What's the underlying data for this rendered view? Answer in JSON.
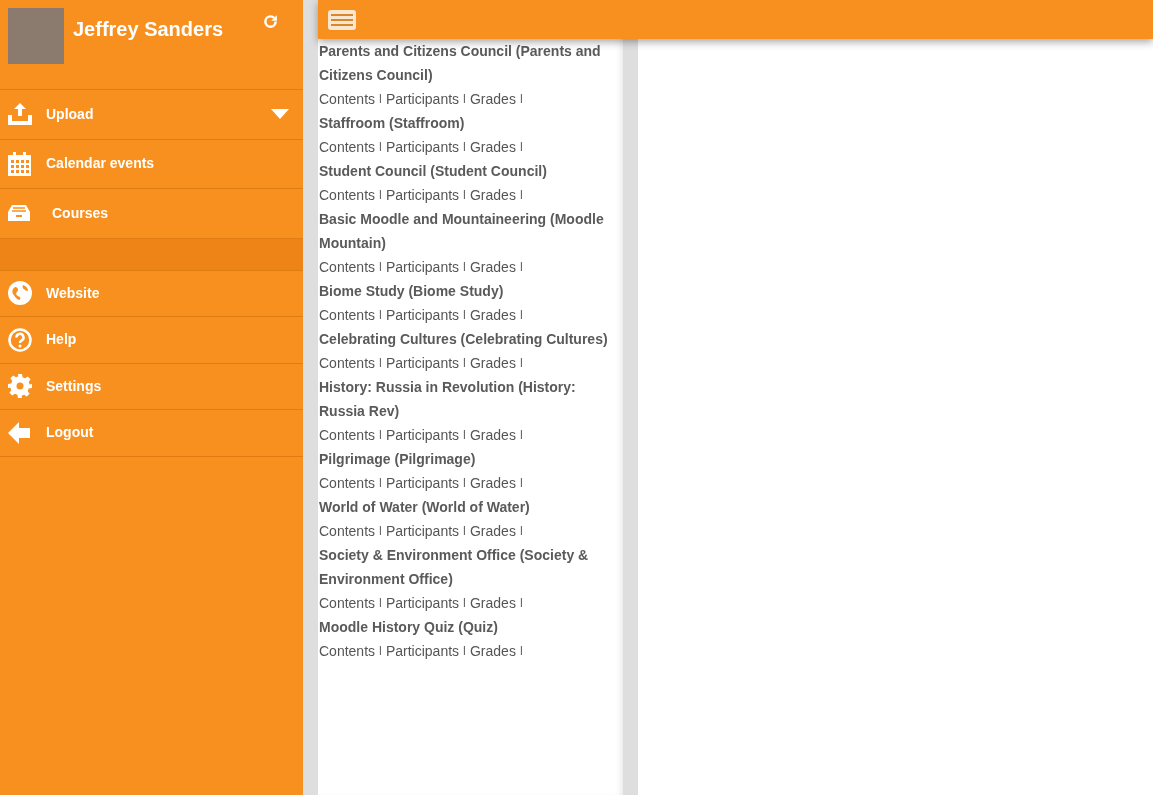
{
  "user": {
    "name": "Jeffrey Sanders"
  },
  "menu_top": [
    {
      "label": "Upload",
      "expandable": true
    },
    {
      "label": "Calendar events",
      "expandable": false
    },
    {
      "label": "Courses",
      "expandable": false
    }
  ],
  "menu_bottom": [
    {
      "label": "Website",
      "expandable": false
    },
    {
      "label": "Help",
      "expandable": false
    },
    {
      "label": "Settings",
      "expandable": false
    },
    {
      "label": "Logout",
      "expandable": false
    }
  ],
  "courses": [
    {
      "title": "Parents and Citizens Council (Parents and Citizens Council)",
      "links": [
        {
          "kind": "link",
          "text": "Contents"
        },
        {
          "kind": "separator",
          "text": "l"
        },
        {
          "kind": "link",
          "text": "Participants"
        },
        {
          "kind": "separator",
          "text": "l"
        },
        {
          "kind": "link",
          "text": "Grades"
        },
        {
          "kind": "separator",
          "text": "l"
        }
      ]
    },
    {
      "title": "Staffroom (Staffroom)",
      "links": [
        {
          "kind": "link",
          "text": "Contents"
        },
        {
          "kind": "separator",
          "text": "l"
        },
        {
          "kind": "link",
          "text": "Participants"
        },
        {
          "kind": "separator",
          "text": "l"
        },
        {
          "kind": "link",
          "text": "Grades"
        },
        {
          "kind": "separator",
          "text": "l"
        }
      ]
    },
    {
      "title": "Student Council (Student Council)",
      "links": [
        {
          "kind": "link",
          "text": "Contents"
        },
        {
          "kind": "separator",
          "text": "l"
        },
        {
          "kind": "link",
          "text": "Participants"
        },
        {
          "kind": "separator",
          "text": "l"
        },
        {
          "kind": "link",
          "text": "Grades"
        },
        {
          "kind": "separator",
          "text": "l"
        }
      ]
    },
    {
      "title": "Basic Moodle and Mountaineering (Moodle Mountain)",
      "links": [
        {
          "kind": "link",
          "text": "Contents"
        },
        {
          "kind": "separator",
          "text": "l"
        },
        {
          "kind": "link",
          "text": "Participants"
        },
        {
          "kind": "separator",
          "text": "l"
        },
        {
          "kind": "link",
          "text": "Grades"
        },
        {
          "kind": "separator",
          "text": "l"
        }
      ]
    },
    {
      "title": "Biome Study (Biome Study)",
      "links": [
        {
          "kind": "link",
          "text": "Contents"
        },
        {
          "kind": "separator",
          "text": "l"
        },
        {
          "kind": "link",
          "text": "Participants"
        },
        {
          "kind": "separator",
          "text": "l"
        },
        {
          "kind": "link",
          "text": "Grades"
        },
        {
          "kind": "separator",
          "text": "l"
        }
      ]
    },
    {
      "title": "Celebrating Cultures (Celebrating Cultures)",
      "links": [
        {
          "kind": "link",
          "text": "Contents"
        },
        {
          "kind": "separator",
          "text": "l"
        },
        {
          "kind": "link",
          "text": "Participants"
        },
        {
          "kind": "separator",
          "text": "l"
        },
        {
          "kind": "link",
          "text": "Grades"
        },
        {
          "kind": "separator",
          "text": "l"
        }
      ]
    },
    {
      "title": "History: Russia in Revolution (History: Russia Rev)",
      "links": [
        {
          "kind": "link",
          "text": "Contents"
        },
        {
          "kind": "separator",
          "text": "l"
        },
        {
          "kind": "link",
          "text": "Participants"
        },
        {
          "kind": "separator",
          "text": "l"
        },
        {
          "kind": "link",
          "text": "Grades"
        },
        {
          "kind": "separator",
          "text": "l"
        }
      ]
    },
    {
      "title": "Pilgrimage (Pilgrimage)",
      "links": [
        {
          "kind": "link",
          "text": "Contents"
        },
        {
          "kind": "separator",
          "text": "l"
        },
        {
          "kind": "link",
          "text": "Participants"
        },
        {
          "kind": "separator",
          "text": "l"
        },
        {
          "kind": "link",
          "text": "Grades"
        },
        {
          "kind": "separator",
          "text": "l"
        }
      ]
    },
    {
      "title": "World of Water (World of Water)",
      "links": [
        {
          "kind": "link",
          "text": "Contents"
        },
        {
          "kind": "separator",
          "text": "l"
        },
        {
          "kind": "link",
          "text": "Participants"
        },
        {
          "kind": "separator",
          "text": "l"
        },
        {
          "kind": "link",
          "text": "Grades"
        },
        {
          "kind": "separator",
          "text": "l"
        }
      ]
    },
    {
      "title": "Society & Environment Office (Society & Environment Office)",
      "links": [
        {
          "kind": "link",
          "text": "Contents"
        },
        {
          "kind": "separator",
          "text": "l"
        },
        {
          "kind": "link",
          "text": "Participants"
        },
        {
          "kind": "separator",
          "text": "l"
        },
        {
          "kind": "link",
          "text": "Grades"
        },
        {
          "kind": "separator",
          "text": "l"
        }
      ]
    },
    {
      "title": "Moodle History Quiz (Quiz)",
      "links": [
        {
          "kind": "link",
          "text": "Contents"
        },
        {
          "kind": "separator",
          "text": "l"
        },
        {
          "kind": "link",
          "text": "Participants"
        },
        {
          "kind": "separator",
          "text": "l"
        },
        {
          "kind": "link",
          "text": "Grades"
        },
        {
          "kind": "separator",
          "text": "l"
        }
      ]
    }
  ]
}
